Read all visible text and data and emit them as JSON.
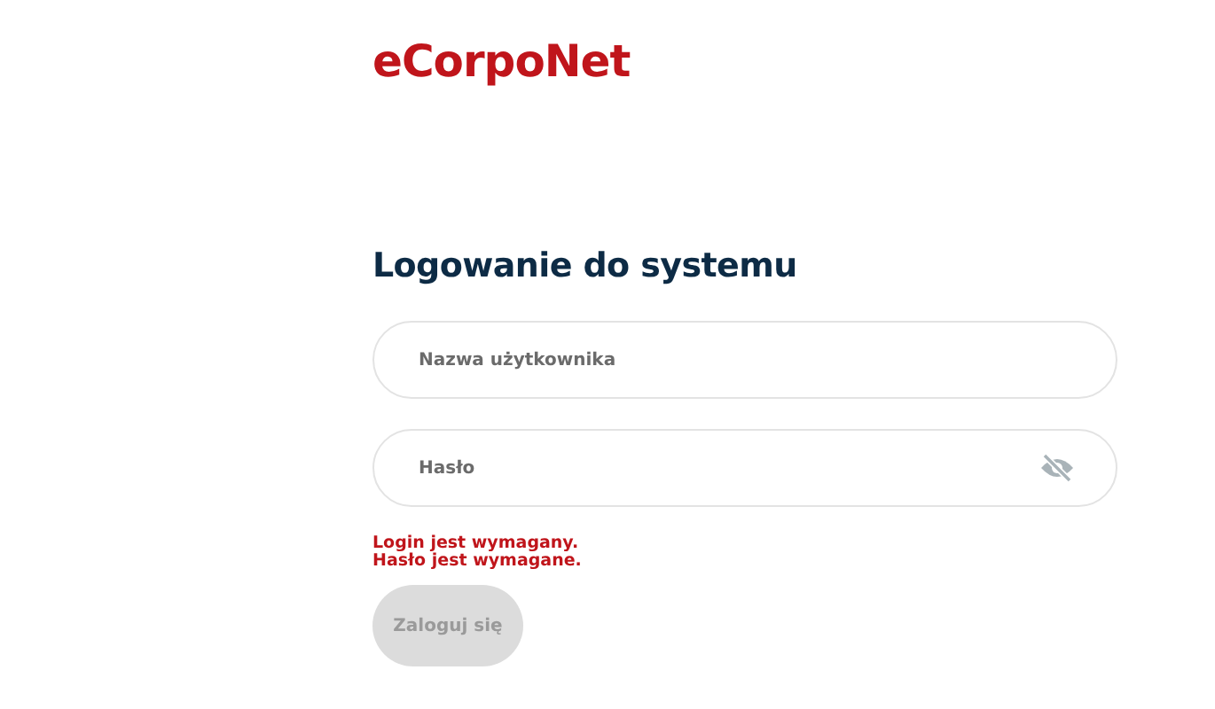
{
  "logo": "eCorpoNet",
  "heading": "Logowanie do systemu",
  "fields": [
    {
      "kind": "text",
      "placeholder": "Nazwa użytkownika"
    },
    {
      "kind": "password",
      "placeholder": "Hasło"
    }
  ],
  "errors": [
    "Login jest wymagany.",
    "Hasło jest wymagane."
  ],
  "submit": {
    "label": "Zaloguj się",
    "disabled": true
  }
}
